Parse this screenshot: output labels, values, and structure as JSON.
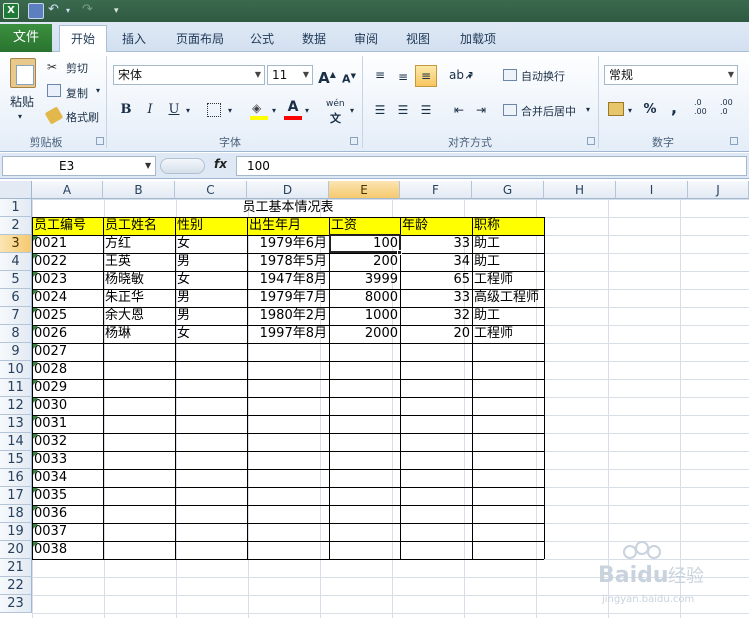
{
  "quick_access": {
    "app_icon_letter": "X"
  },
  "tabs": {
    "file": "文件",
    "items": [
      "开始",
      "插入",
      "页面布局",
      "公式",
      "数据",
      "审阅",
      "视图",
      "加载项"
    ],
    "active": "开始"
  },
  "ribbon": {
    "clipboard": {
      "paste": "粘贴",
      "cut": "剪切",
      "copy": "复制",
      "format_painter": "格式刷",
      "group": "剪贴板"
    },
    "font": {
      "name": "宋体",
      "size": "11",
      "grow": "A",
      "shrink": "A",
      "bold": "B",
      "italic": "I",
      "underline": "U",
      "wen": "wén",
      "group": "字体"
    },
    "alignment": {
      "wrap": "自动换行",
      "merge": "合并后居中",
      "group": "对齐方式"
    },
    "number": {
      "format": "常规",
      "percent": "%",
      "comma": ",",
      "dec_inc": ".0 .00",
      "dec_dec": ".00 .0",
      "group": "数字"
    }
  },
  "formula_bar": {
    "name_box": "E3",
    "fx": "fx",
    "value": "100"
  },
  "columns": [
    "A",
    "B",
    "C",
    "D",
    "E",
    "F",
    "G",
    "H",
    "I",
    "J"
  ],
  "selected_column": "E",
  "rows": [
    "1",
    "2",
    "3",
    "4",
    "5",
    "6",
    "7",
    "8",
    "9",
    "10",
    "11",
    "12",
    "13",
    "14",
    "15",
    "16",
    "17",
    "18",
    "19",
    "20",
    "21",
    "22",
    "23"
  ],
  "selected_row": "3",
  "sheet": {
    "title": "员工基本情况表",
    "headers": [
      "员工编号",
      "员工姓名",
      "性别",
      "出生年月",
      "工资",
      "年龄",
      "职称"
    ],
    "header_bg": "#ffff00",
    "records": [
      {
        "id": "0021",
        "name": "方红",
        "sex": "女",
        "birth": "1979年6月",
        "salary": "100",
        "age": "33",
        "title": "助工"
      },
      {
        "id": "0022",
        "name": "王英",
        "sex": "男",
        "birth": "1978年5月",
        "salary": "200",
        "age": "34",
        "title": "助工"
      },
      {
        "id": "0023",
        "name": "杨晓敏",
        "sex": "女",
        "birth": "1947年8月",
        "salary": "3999",
        "age": "65",
        "title": "工程师"
      },
      {
        "id": "0024",
        "name": "朱正华",
        "sex": "男",
        "birth": "1979年7月",
        "salary": "8000",
        "age": "33",
        "title": "高级工程师"
      },
      {
        "id": "0025",
        "name": "余大恩",
        "sex": "男",
        "birth": "1980年2月",
        "salary": "1000",
        "age": "32",
        "title": "助工"
      },
      {
        "id": "0026",
        "name": "杨琳",
        "sex": "女",
        "birth": "1997年8月",
        "salary": "2000",
        "age": "20",
        "title": "工程师"
      }
    ],
    "empty_ids": [
      "0027",
      "0028",
      "0029",
      "0030",
      "0031",
      "0032",
      "0033",
      "0034",
      "0035",
      "0036",
      "0037",
      "0038"
    ]
  }
}
